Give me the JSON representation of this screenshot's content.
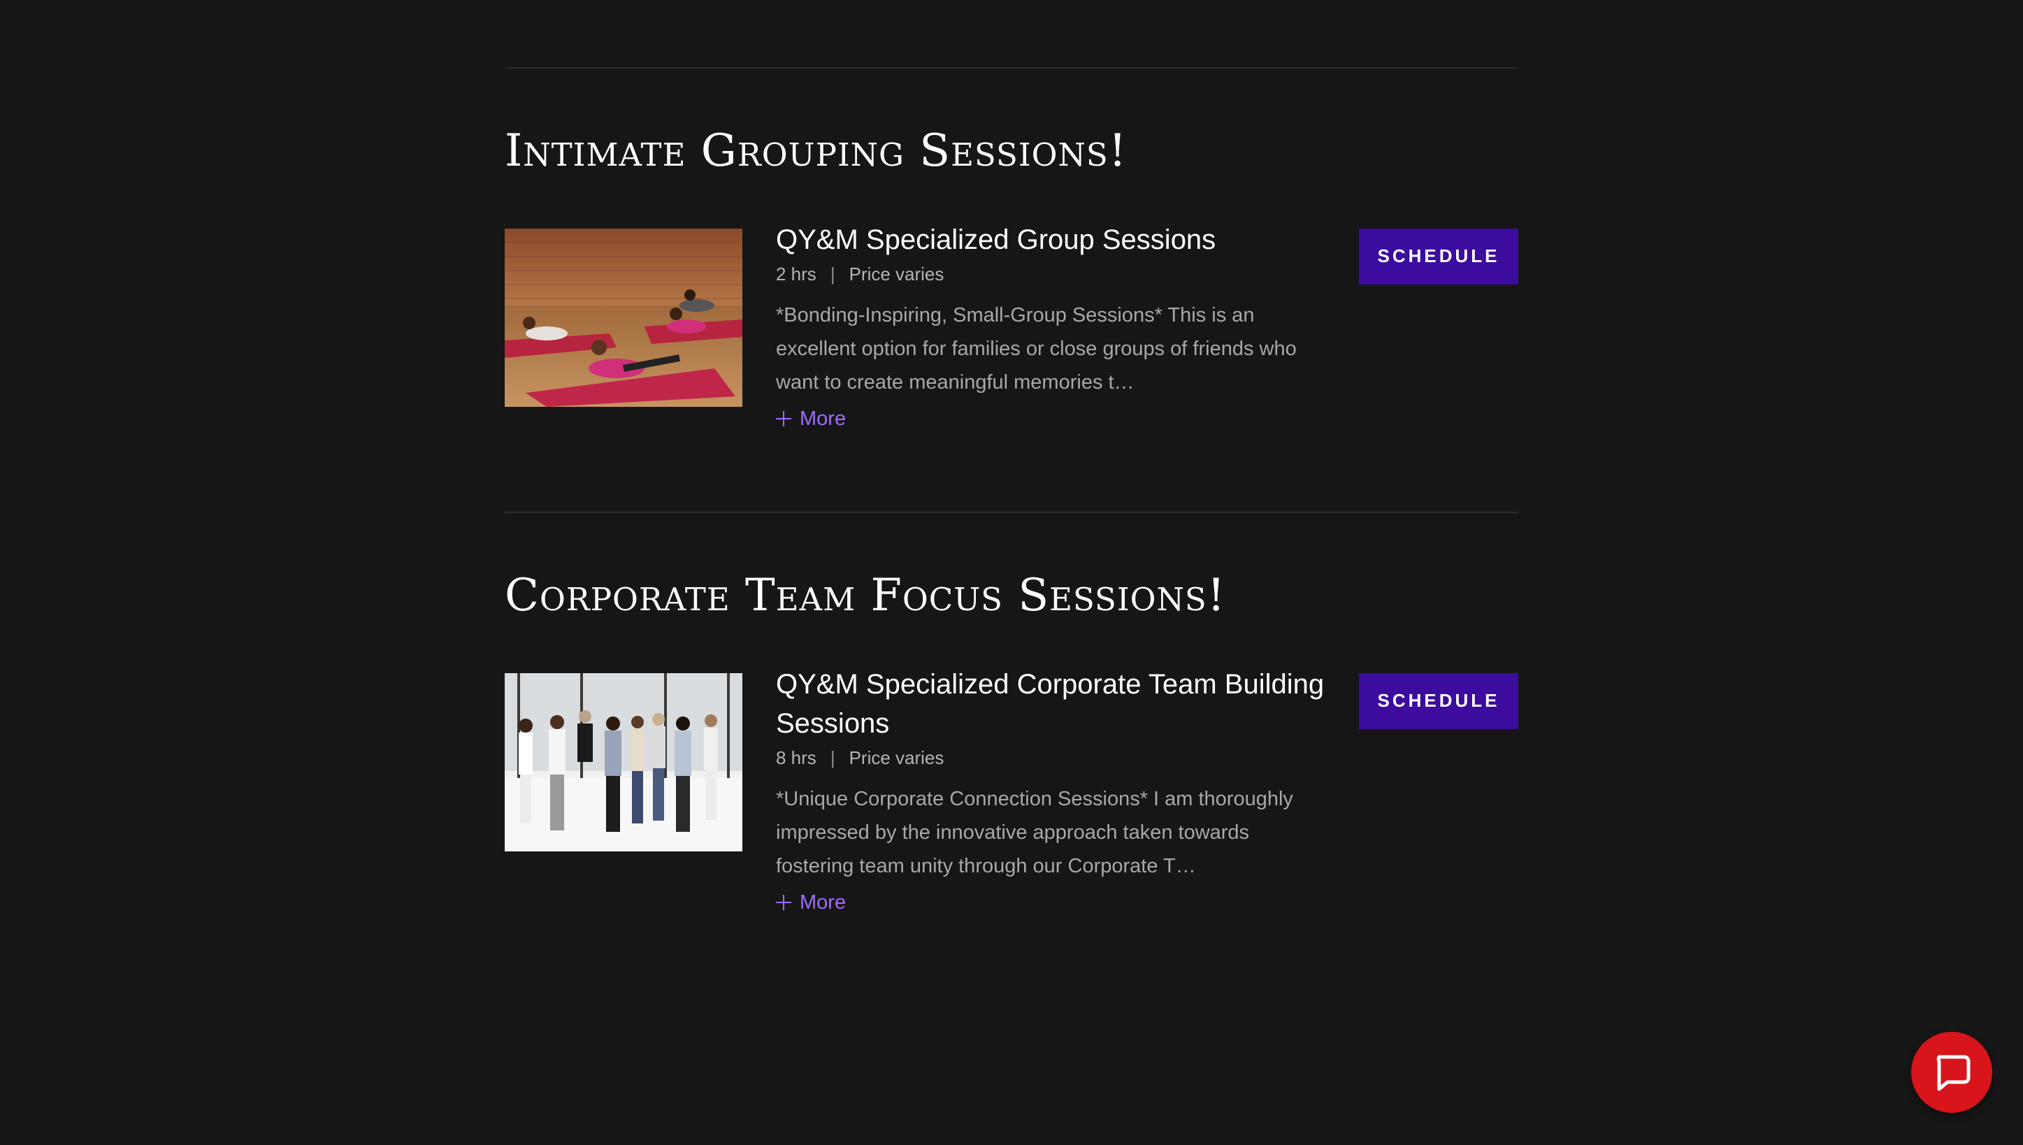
{
  "sections": [
    {
      "title": "Intimate Grouping Sessions!",
      "service": {
        "name": "QY&M Specialized Group Sessions",
        "duration": "2 hrs",
        "separator": "|",
        "price": "Price varies",
        "description": "*Bonding-Inspiring, Small-Group Sessions* This is an excellent option for families or close groups of friends who want to create meaningful memories t…",
        "more_label": "More",
        "schedule_label": "Schedule",
        "image_icon": "yoga-group-photo"
      }
    },
    {
      "title": "Corporate Team Focus Sessions!",
      "service": {
        "name": "QY&M Specialized Corporate Team Building Sessions",
        "duration": "8 hrs",
        "separator": "|",
        "price": "Price varies",
        "description": "*Unique Corporate Connection Sessions* I am thoroughly impressed by the innovative approach taken towards fostering team unity through our Corporate T…",
        "more_label": "More",
        "schedule_label": "Schedule",
        "image_icon": "corporate-team-photo"
      }
    }
  ],
  "chat": {
    "icon": "chat-bubble-icon"
  },
  "colors": {
    "background": "#161617",
    "accent_button": "#3b0c9e",
    "link": "#a06bff",
    "chat_button": "#d8151a"
  }
}
